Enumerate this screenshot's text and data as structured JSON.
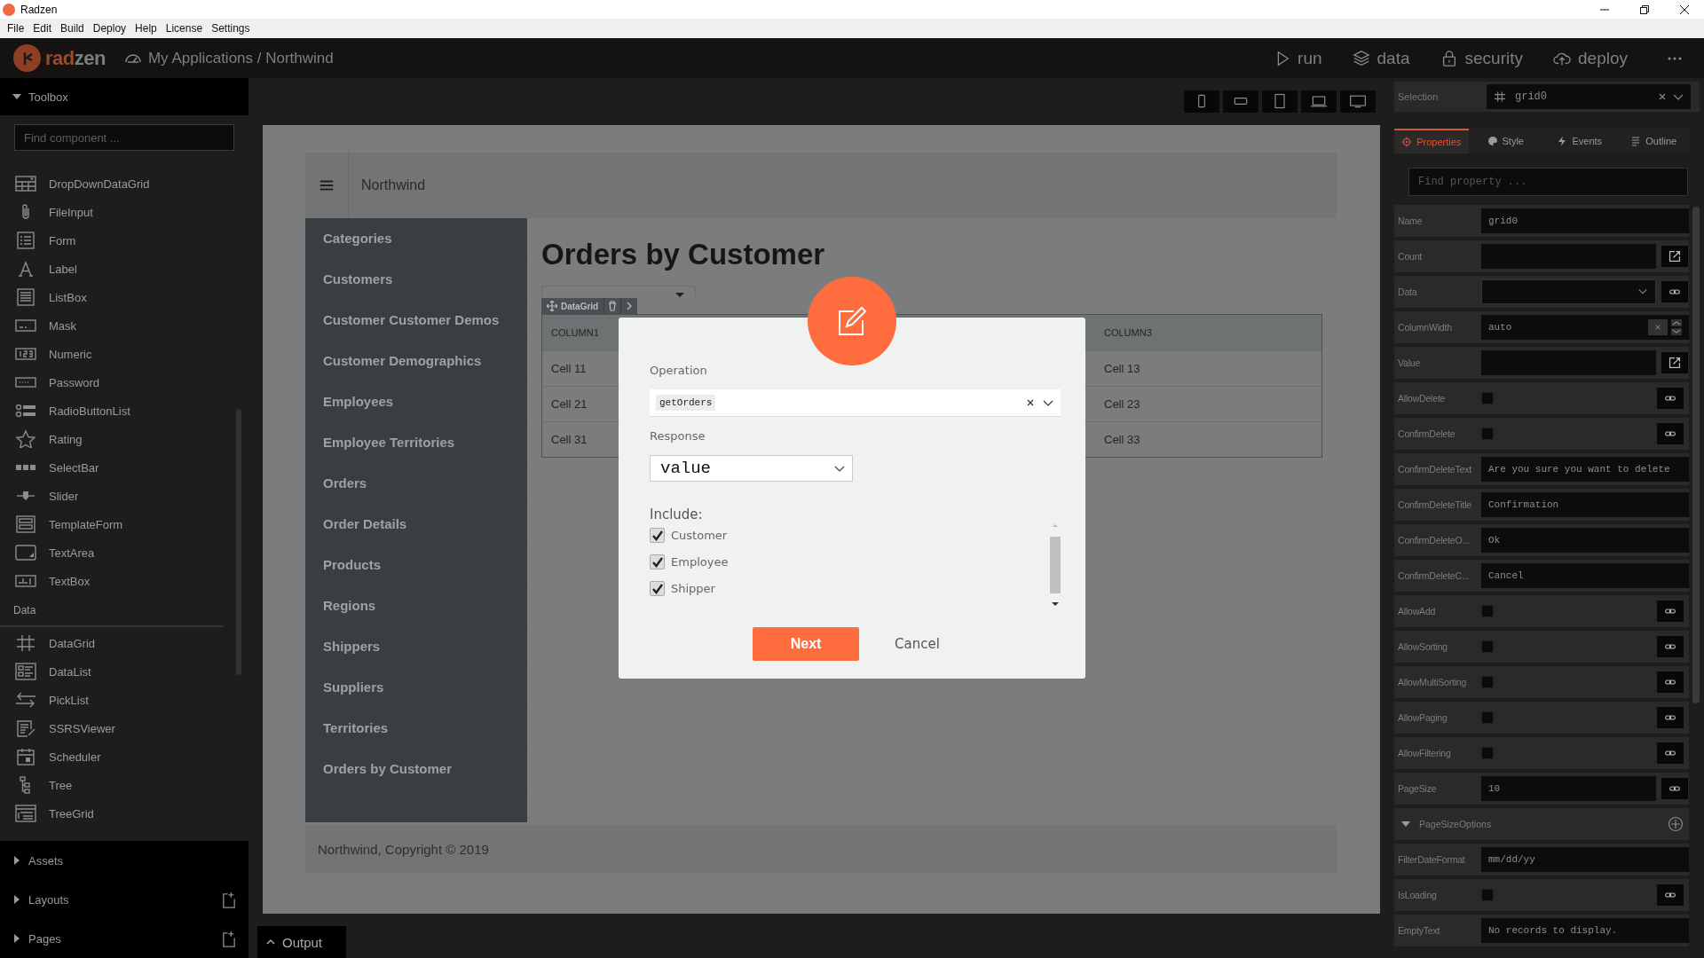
{
  "window": {
    "title": "Radzen"
  },
  "menu": [
    "File",
    "Edit",
    "Build",
    "Deploy",
    "Help",
    "License",
    "Settings"
  ],
  "header": {
    "logo": [
      "rad",
      "zen"
    ],
    "breadcrumb": "My Applications / Northwind",
    "actions": [
      {
        "kind": "run",
        "label": "run"
      },
      {
        "kind": "data",
        "label": "data"
      },
      {
        "kind": "security",
        "label": "security"
      },
      {
        "kind": "deploy",
        "label": "deploy"
      }
    ]
  },
  "toolbox": {
    "title": "Toolbox",
    "expanded": true,
    "placeholder": "Find component ...",
    "items": [
      "DropDownDataGrid",
      "FileInput",
      "Form",
      "Label",
      "ListBox",
      "Mask",
      "Numeric",
      "Password",
      "RadioButtonList",
      "Rating",
      "SelectBar",
      "Slider",
      "TemplateForm",
      "TextArea",
      "TextBox"
    ],
    "section": {
      "title": "Data",
      "items": [
        "DataGrid",
        "DataList",
        "PickList",
        "SSRSViewer",
        "Scheduler",
        "Tree",
        "TreeGrid"
      ]
    }
  },
  "panels": [
    {
      "title": "Assets",
      "expanded": false,
      "addable": false
    },
    {
      "title": "Layouts",
      "expanded": false,
      "addable": true
    },
    {
      "title": "Pages",
      "expanded": false,
      "addable": true
    }
  ],
  "devices": [
    {
      "kind": "phone"
    },
    {
      "kind": "phone-landscape"
    },
    {
      "kind": "tablet"
    },
    {
      "kind": "laptop"
    },
    {
      "kind": "desktop"
    }
  ],
  "canvas": {
    "app_title": "Northwind",
    "nav": [
      "Categories",
      "Customers",
      "Customer Customer Demos",
      "Customer Demographics",
      "Employees",
      "Employee Territories",
      "Orders",
      "Order Details",
      "Products",
      "Regions",
      "Shippers",
      "Suppliers",
      "Territories",
      "Orders by Customer"
    ],
    "page_title": "Orders by Customer",
    "grid": {
      "tag": "DataGrid",
      "columns": [
        "COLUMN1",
        "COLUMN3"
      ],
      "rows": [
        [
          "Cell 11",
          "Cell 13"
        ],
        [
          "Cell 21",
          "Cell 23"
        ],
        [
          "Cell 31",
          "Cell 33"
        ]
      ]
    },
    "footer": "Northwind, Copyright © 2019"
  },
  "dialog": {
    "operation_label": "Operation",
    "operation": "getOrders",
    "response_label": "Response",
    "response": "value",
    "include_label": "Include:",
    "includes": [
      {
        "label": "Customer",
        "checked": true
      },
      {
        "label": "Employee",
        "checked": true
      },
      {
        "label": "Shipper",
        "checked": true
      }
    ],
    "primary": "Next",
    "secondary": "Cancel"
  },
  "output": {
    "label": "Output"
  },
  "inspector": {
    "selection_label": "Selection",
    "selection": "grid0",
    "tabs": [
      {
        "label": "Properties",
        "kind": "gear",
        "selected": true
      },
      {
        "label": "Style",
        "kind": "palette",
        "selected": false
      },
      {
        "label": "Events",
        "kind": "bolt",
        "selected": false
      },
      {
        "label": "Outline",
        "kind": "lines",
        "selected": false
      }
    ],
    "placeholder": "Find property ...",
    "properties": [
      {
        "name": "Name",
        "kind": "text",
        "value": "grid0"
      },
      {
        "name": "Count",
        "kind": "popup"
      },
      {
        "name": "Data",
        "kind": "select"
      },
      {
        "name": "ColumnWidth",
        "kind": "spin",
        "value": "auto"
      },
      {
        "name": "Value",
        "kind": "popup"
      },
      {
        "name": "AllowDelete",
        "kind": "check",
        "checked": false
      },
      {
        "name": "ConfirmDelete",
        "kind": "check",
        "checked": false
      },
      {
        "name": "ConfirmDeleteText",
        "kind": "text",
        "value": "Are you sure you want to delete"
      },
      {
        "name": "ConfirmDeleteTitle",
        "kind": "text",
        "value": "Confirmation"
      },
      {
        "name": "ConfirmDeleteO...",
        "kind": "text",
        "value": "Ok"
      },
      {
        "name": "ConfirmDeleteC...",
        "kind": "text",
        "value": "Cancel"
      },
      {
        "name": "AllowAdd",
        "kind": "check",
        "checked": false
      },
      {
        "name": "AllowSorting",
        "kind": "check",
        "checked": false
      },
      {
        "name": "AllowMultiSorting",
        "kind": "check",
        "checked": false
      },
      {
        "name": "AllowPaging",
        "kind": "check",
        "checked": false
      },
      {
        "name": "AllowFiltering",
        "kind": "check",
        "checked": false
      },
      {
        "name": "PageSize",
        "kind": "bind",
        "value": "10"
      },
      {
        "name": "PageSizeOptions",
        "kind": "group"
      },
      {
        "name": "FilterDateFormat",
        "kind": "text",
        "value": "mm/dd/yy"
      },
      {
        "name": "IsLoading",
        "kind": "check",
        "checked": false
      },
      {
        "name": "EmptyText",
        "kind": "text",
        "value": "No records to display."
      }
    ]
  }
}
